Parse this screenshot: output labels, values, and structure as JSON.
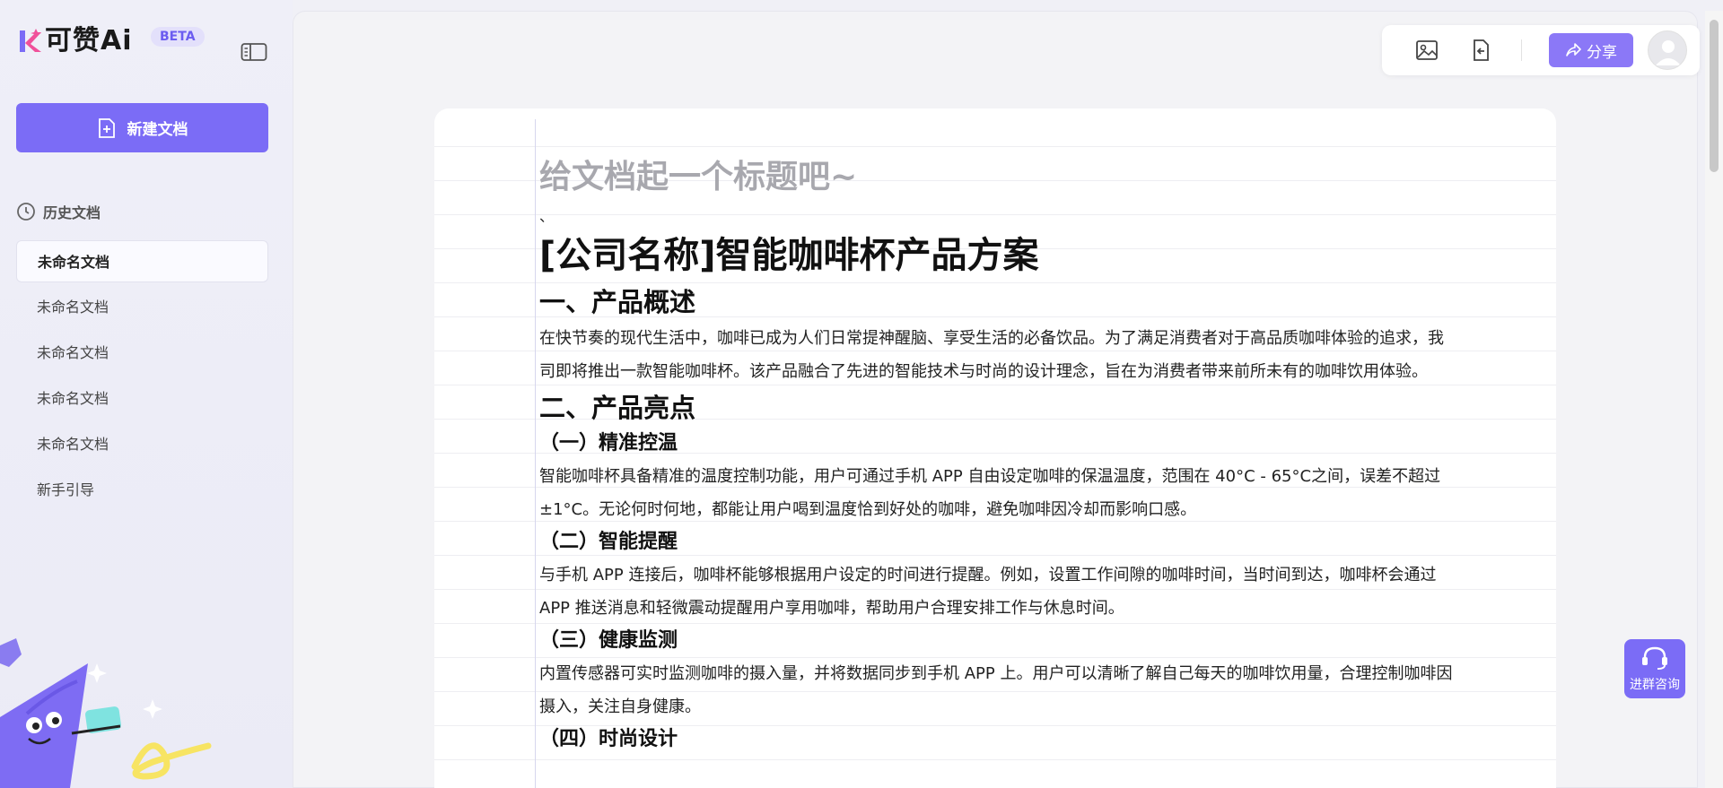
{
  "sidebar": {
    "logo_text": "可赞Ai",
    "beta": "BETA",
    "new_doc_label": "新建文档",
    "history_label": "历史文档",
    "docs": [
      "未命名文档",
      "未命名文档",
      "未命名文档",
      "未命名文档",
      "未命名文档",
      "新手引导"
    ]
  },
  "topbar": {
    "share_label": "分享"
  },
  "document": {
    "title_placeholder": "给文档起一个标题吧~",
    "stray": "、",
    "heading": "[公司名称]智能咖啡杯产品方案",
    "s1_title": "一、产品概述",
    "s1_body": "在快节奏的现代生活中，咖啡已成为人们日常提神醒脑、享受生活的必备饮品。为了满足消费者对于高品质咖啡体验的追求，我司即将推出一款智能咖啡杯。该产品融合了先进的智能技术与时尚的设计理念，旨在为消费者带来前所未有的咖啡饮用体验。",
    "s2_title": "二、产品亮点",
    "s2_1_title": "（一）精准控温",
    "s2_1_body": "智能咖啡杯具备精准的温度控制功能，用户可通过手机 APP 自由设定咖啡的保温温度，范围在 40°C - 65°C之间，误差不超过±1°C。无论何时何地，都能让用户喝到温度恰到好处的咖啡，避免咖啡因冷却而影响口感。",
    "s2_2_title": "（二）智能提醒",
    "s2_2_body": "与手机 APP 连接后，咖啡杯能够根据用户设定的时间进行提醒。例如，设置工作间隙的咖啡时间，当时间到达，咖啡杯会通过 APP 推送消息和轻微震动提醒用户享用咖啡，帮助用户合理安排工作与休息时间。",
    "s2_3_title": "（三）健康监测",
    "s2_3_body": "内置传感器可实时监测咖啡的摄入量，并将数据同步到手机 APP 上。用户可以清晰了解自己每天的咖啡饮用量，合理控制咖啡因摄入，关注自身健康。",
    "s2_4_title": "（四）时尚设计"
  },
  "consult_label": "进群咨询",
  "colors": {
    "accent": "#7b6cf6",
    "share": "#8b78f7"
  }
}
